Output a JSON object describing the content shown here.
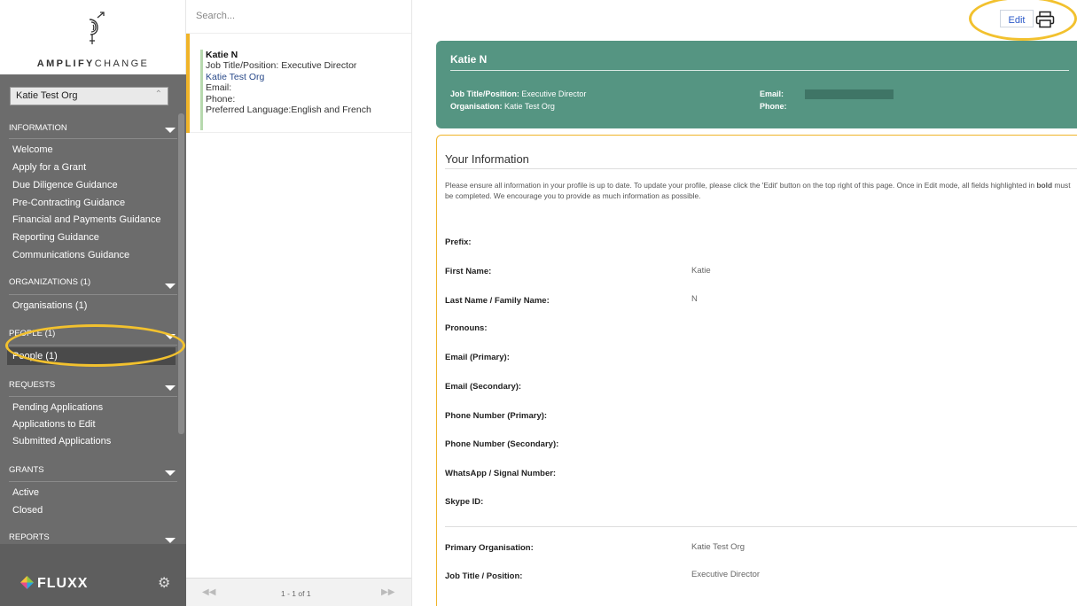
{
  "brand": {
    "logo_prefix": "AMPLIFY",
    "logo_suffix": "CHANGE",
    "footer_logo": "FLUXX",
    "accent_yellow": "#f0b429",
    "header_green": "#559582",
    "sidebar_grey": "#6c6c6c"
  },
  "sidebar": {
    "org_select_value": "Katie Test Org",
    "sections": [
      {
        "title": "INFORMATION",
        "items": [
          "Welcome",
          "Apply for a Grant",
          "Due Diligence Guidance",
          "Pre-Contracting Guidance",
          "Financial and Payments Guidance",
          "Reporting Guidance",
          "Communications Guidance"
        ]
      },
      {
        "title": "ORGANIZATIONS (1)",
        "items": [
          "Organisations  (1)"
        ]
      },
      {
        "title": "PEOPLE (1)",
        "items": [
          "People  (1)"
        ]
      },
      {
        "title": "REQUESTS",
        "items": [
          "Pending Applications",
          "Applications to Edit",
          "Submitted Applications"
        ]
      },
      {
        "title": "GRANTS",
        "items": [
          "Active",
          "Closed"
        ]
      },
      {
        "title": "REPORTS",
        "items": []
      }
    ],
    "active_item": "People  (1)"
  },
  "list": {
    "search_placeholder": "Search...",
    "card": {
      "name": "Katie N",
      "title_line": "Job Title/Position: Executive Director",
      "org": "Katie Test Org",
      "email": "Email:",
      "phone": "Phone:",
      "language": "Preferred Language:English and French"
    },
    "pager": {
      "info": "1 - 1 of 1",
      "prev": "◀◀",
      "next": "▶▶"
    }
  },
  "main": {
    "edit_label": "Edit",
    "header": {
      "name": "Katie N",
      "job_label": "Job Title/Position:",
      "job_value": " Executive Director",
      "org_label": "Organisation:",
      "org_value": " Katie Test Org",
      "email_label": "Email:",
      "phone_label": "Phone:"
    },
    "info_title": "Your Information",
    "desc_pre": "Please ensure all information in your profile is up to date. To update your profile, please click the 'Edit' button on the top right of this page. Once in Edit mode, all fields highlighted in ",
    "desc_bold": "bold",
    "desc_post": " must be completed. We encourage you to provide as much information as possible.",
    "fields": [
      {
        "label": "Prefix:",
        "value": ""
      },
      {
        "label": "First Name:",
        "value": "Katie"
      },
      {
        "label": "Last Name / Family Name:",
        "value": "N"
      },
      {
        "label": "Pronouns:",
        "value": ""
      },
      {
        "label": "Email (Primary):",
        "value": ""
      },
      {
        "label": "Email (Secondary):",
        "value": ""
      },
      {
        "label": "Phone Number (Primary):",
        "value": ""
      },
      {
        "label": "Phone Number (Secondary):",
        "value": ""
      },
      {
        "label": "WhatsApp / Signal Number:",
        "value": ""
      },
      {
        "label": "Skype ID:",
        "value": ""
      },
      {
        "label": "Primary Organisation:",
        "value": "Katie Test Org"
      },
      {
        "label": "Job Title / Position:",
        "value": "Executive Director"
      }
    ]
  }
}
